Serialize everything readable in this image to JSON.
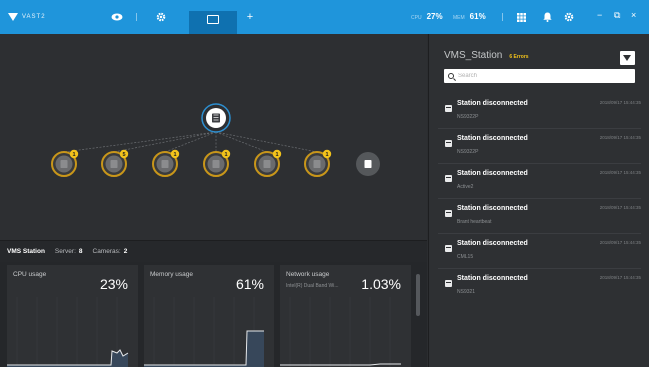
{
  "topbar": {
    "logo_text": "VAST2",
    "icons": [
      "eye-icon",
      "gear-icon",
      "monitor-icon",
      "plus-icon",
      "grid-icon",
      "bell-icon",
      "settings-icon"
    ],
    "cpu": {
      "label": "CPU",
      "value": "27%"
    },
    "memory": {
      "label": "MEM",
      "value": "61%"
    },
    "window": {
      "minimize": "−",
      "restore": "⧉",
      "close": "×"
    },
    "accent": "#1f95db"
  },
  "topology": {
    "nodes": [
      {
        "icon": "server-icon",
        "badge": "1"
      },
      {
        "icon": "server-icon",
        "badge": "5"
      },
      {
        "icon": "server-icon",
        "badge": "1"
      },
      {
        "icon": "server-icon",
        "badge": "1"
      },
      {
        "icon": "server-icon",
        "badge": "1"
      },
      {
        "icon": "server-icon",
        "badge": "1"
      },
      {
        "icon": "server-icon",
        "badge": ""
      }
    ],
    "badge_color": "#f2c21b"
  },
  "station_bar": {
    "title": "VMS Station",
    "server_label": "Server:",
    "server_value": "8",
    "cameras_label": "Cameras:",
    "cameras_value": "2"
  },
  "usage": {
    "cpu": {
      "title": "CPU usage",
      "value": "23%",
      "level": 23
    },
    "memory": {
      "title": "Memory usage",
      "value": "61%",
      "level": 61
    },
    "network": {
      "title": "Network usage",
      "subtitle": "Intel(R) Dual Band Wi...",
      "value": "1.03%",
      "level": 1.03
    }
  },
  "events": {
    "title": "VMS_Station",
    "badge": "6 Errors",
    "search_placeholder": "Search",
    "items": [
      {
        "name": "Station disconnected",
        "sub": "NS9322P",
        "time": "2018/09/17 15:44:35"
      },
      {
        "name": "Station disconnected",
        "sub": "NS9322P",
        "time": "2018/09/17 15:44:35"
      },
      {
        "name": "Station disconnected",
        "sub": "Active2",
        "time": "2018/09/17 15:44:35"
      },
      {
        "name": "Station disconnected",
        "sub": "Brant heartbeat",
        "time": "2018/09/17 15:44:35"
      },
      {
        "name": "Station disconnected",
        "sub": "CML15",
        "time": "2018/09/17 15:44:35"
      },
      {
        "name": "Station disconnected",
        "sub": "NS9321",
        "time": "2018/09/17 15:44:35"
      }
    ]
  }
}
